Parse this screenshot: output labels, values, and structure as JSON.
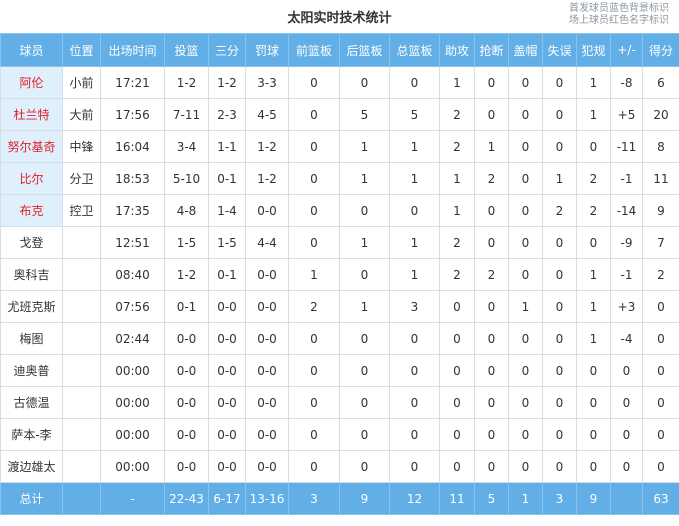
{
  "header": {
    "title": "太阳实时技术统计",
    "note_line1": "首发球员蓝色背景标识",
    "note_line2": "场上球员红色名字标识"
  },
  "columns": [
    "球员",
    "位置",
    "出场时间",
    "投篮",
    "三分",
    "罚球",
    "前篮板",
    "后篮板",
    "总篮板",
    "助攻",
    "抢断",
    "盖帽",
    "失误",
    "犯规",
    "+/-",
    "得分"
  ],
  "rows": [
    {
      "starter": true,
      "cells": [
        "阿伦",
        "小前",
        "17:21",
        "1-2",
        "1-2",
        "3-3",
        "0",
        "0",
        "0",
        "1",
        "0",
        "0",
        "0",
        "1",
        "-8",
        "6"
      ]
    },
    {
      "starter": true,
      "cells": [
        "杜兰特",
        "大前",
        "17:56",
        "7-11",
        "2-3",
        "4-5",
        "0",
        "5",
        "5",
        "2",
        "0",
        "0",
        "0",
        "1",
        "+5",
        "20"
      ]
    },
    {
      "starter": true,
      "cells": [
        "努尔基奇",
        "中锋",
        "16:04",
        "3-4",
        "1-1",
        "1-2",
        "0",
        "1",
        "1",
        "2",
        "1",
        "0",
        "0",
        "0",
        "-11",
        "8"
      ]
    },
    {
      "starter": true,
      "cells": [
        "比尔",
        "分卫",
        "18:53",
        "5-10",
        "0-1",
        "1-2",
        "0",
        "1",
        "1",
        "1",
        "2",
        "0",
        "1",
        "2",
        "-1",
        "11"
      ]
    },
    {
      "starter": true,
      "cells": [
        "布克",
        "控卫",
        "17:35",
        "4-8",
        "1-4",
        "0-0",
        "0",
        "0",
        "0",
        "1",
        "0",
        "0",
        "2",
        "2",
        "-14",
        "9"
      ]
    },
    {
      "starter": false,
      "cells": [
        "戈登",
        "",
        "12:51",
        "1-5",
        "1-5",
        "4-4",
        "0",
        "1",
        "1",
        "2",
        "0",
        "0",
        "0",
        "0",
        "-9",
        "7"
      ]
    },
    {
      "starter": false,
      "cells": [
        "奥科吉",
        "",
        "08:40",
        "1-2",
        "0-1",
        "0-0",
        "1",
        "0",
        "1",
        "2",
        "2",
        "0",
        "0",
        "1",
        "-1",
        "2"
      ]
    },
    {
      "starter": false,
      "cells": [
        "尤班克斯",
        "",
        "07:56",
        "0-1",
        "0-0",
        "0-0",
        "2",
        "1",
        "3",
        "0",
        "0",
        "1",
        "0",
        "1",
        "+3",
        "0"
      ]
    },
    {
      "starter": false,
      "cells": [
        "梅图",
        "",
        "02:44",
        "0-0",
        "0-0",
        "0-0",
        "0",
        "0",
        "0",
        "0",
        "0",
        "0",
        "0",
        "1",
        "-4",
        "0"
      ]
    },
    {
      "starter": false,
      "cells": [
        "迪奥普",
        "",
        "00:00",
        "0-0",
        "0-0",
        "0-0",
        "0",
        "0",
        "0",
        "0",
        "0",
        "0",
        "0",
        "0",
        "0",
        "0"
      ]
    },
    {
      "starter": false,
      "cells": [
        "古德温",
        "",
        "00:00",
        "0-0",
        "0-0",
        "0-0",
        "0",
        "0",
        "0",
        "0",
        "0",
        "0",
        "0",
        "0",
        "0",
        "0"
      ]
    },
    {
      "starter": false,
      "cells": [
        "萨本-李",
        "",
        "00:00",
        "0-0",
        "0-0",
        "0-0",
        "0",
        "0",
        "0",
        "0",
        "0",
        "0",
        "0",
        "0",
        "0",
        "0"
      ]
    },
    {
      "starter": false,
      "cells": [
        "渡边雄太",
        "",
        "00:00",
        "0-0",
        "0-0",
        "0-0",
        "0",
        "0",
        "0",
        "0",
        "0",
        "0",
        "0",
        "0",
        "0",
        "0"
      ]
    }
  ],
  "totals": [
    "总计",
    "",
    "-",
    "22-43",
    "6-17",
    "13-16",
    "3",
    "9",
    "12",
    "11",
    "5",
    "1",
    "3",
    "9",
    "",
    "63"
  ],
  "colors": {
    "header_bg": "#62aee6",
    "starter_bg": "#dfeffb",
    "on_court_name": "#e0202b"
  }
}
